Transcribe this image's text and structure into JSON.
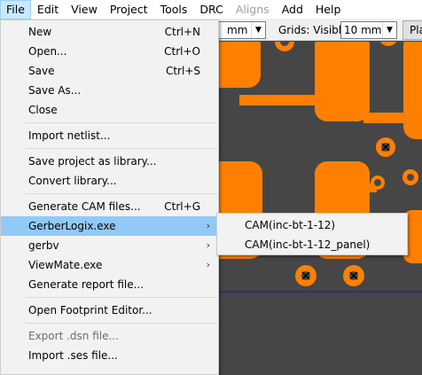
{
  "menubar": {
    "items": [
      "File",
      "Edit",
      "View",
      "Project",
      "Tools",
      "DRC",
      "Aligns",
      "Add",
      "Help"
    ]
  },
  "toolbar": {
    "unit_combo": "mm",
    "grids_label": "Grids: Visible",
    "grid_combo": "10 mm",
    "pla_button": "Pla"
  },
  "file_menu": {
    "groups": [
      [
        {
          "label": "New",
          "shortcut": "Ctrl+N"
        },
        {
          "label": "Open...",
          "shortcut": "Ctrl+O"
        },
        {
          "label": "Save",
          "shortcut": "Ctrl+S"
        },
        {
          "label": "Save As...",
          "shortcut": ""
        },
        {
          "label": "Close",
          "shortcut": ""
        }
      ],
      [
        {
          "label": "Import netlist...",
          "shortcut": ""
        }
      ],
      [
        {
          "label": "Save project as library...",
          "shortcut": ""
        },
        {
          "label": "Convert library...",
          "shortcut": ""
        }
      ],
      [
        {
          "label": "Generate CAM files...",
          "shortcut": "Ctrl+G"
        },
        {
          "label": "GerberLogix.exe",
          "shortcut": "",
          "submenu": true,
          "highlighted": true
        },
        {
          "label": "gerbv",
          "shortcut": "",
          "submenu": true
        },
        {
          "label": "ViewMate.exe",
          "shortcut": "",
          "submenu": true
        },
        {
          "label": "Generate report file...",
          "shortcut": ""
        }
      ],
      [
        {
          "label": "Open Footprint Editor...",
          "shortcut": ""
        }
      ],
      [
        {
          "label": "Export .dsn file...",
          "shortcut": "",
          "disabled": true
        },
        {
          "label": "Import .ses file...",
          "shortcut": ""
        }
      ]
    ]
  },
  "submenu": {
    "items": [
      "CAM(inc-bt-1-12)",
      "CAM(inc-bt-1-12_panel)"
    ]
  },
  "colors": {
    "pad": "#ff8000",
    "board_background": "#464646",
    "highlight": "#91c9f7",
    "menu_background": "#f2f2f2"
  }
}
